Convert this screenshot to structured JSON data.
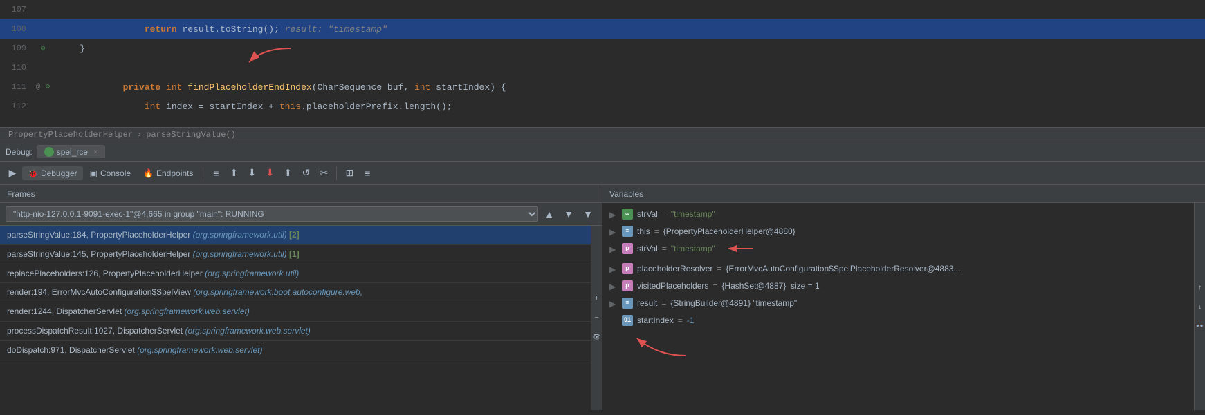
{
  "code": {
    "lines": [
      {
        "num": 107,
        "content": "",
        "highlighted": false,
        "gutter": ""
      },
      {
        "num": 108,
        "content": "        return result.toString();",
        "comment": "   result: \"timestamp\"",
        "highlighted": true,
        "gutter": ""
      },
      {
        "num": 109,
        "content": "    }",
        "highlighted": false,
        "gutter": "⊙"
      },
      {
        "num": 110,
        "content": "",
        "highlighted": false,
        "gutter": ""
      },
      {
        "num": 111,
        "content": "    private int findPlaceholderEndIndex(CharSequence buf, int startIndex) {",
        "highlighted": false,
        "gutter": "@",
        "gutter2": "⊙"
      },
      {
        "num": 112,
        "content": "        int index = startIndex + this.placeholderPrefix.length();",
        "highlighted": false,
        "gutter": ""
      }
    ]
  },
  "breadcrumb": {
    "class": "PropertyPlaceholderHelper",
    "method": "parseStringValue()",
    "separator": "›"
  },
  "debug": {
    "label": "Debug:",
    "tab": "spel_rce",
    "close": "×"
  },
  "toolbar": {
    "debugger_label": "Debugger",
    "console_label": "Console",
    "endpoints_label": "Endpoints"
  },
  "frames": {
    "header": "Frames",
    "thread_label": "\"http-nio-127.0.0.1-9091-exec-1\"@4,665 in group \"main\": RUNNING",
    "items": [
      {
        "method": "parseStringValue:184,",
        "class": "PropertyPlaceholderHelper",
        "package": "(org.springframework.util)",
        "num": "[2]",
        "active": true
      },
      {
        "method": "parseStringValue:145,",
        "class": "PropertyPlaceholderHelper",
        "package": "(org.springframework.util)",
        "num": "[1]",
        "active": false
      },
      {
        "method": "replacePlaceholders:126,",
        "class": "PropertyPlaceholderHelper",
        "package": "(org.springframework.util)",
        "num": "",
        "active": false
      },
      {
        "method": "render:194,",
        "class": "ErrorMvcAutoConfiguration$SpelView",
        "package": "(org.springframework.boot.autoconfigure.web,",
        "num": "",
        "active": false
      },
      {
        "method": "render:1244,",
        "class": "DispatcherServlet",
        "package": "(org.springframework.web.servlet)",
        "num": "",
        "active": false
      },
      {
        "method": "processDispatchResult:1027,",
        "class": "DispatcherServlet",
        "package": "(org.springframework.web.servlet)",
        "num": "",
        "active": false
      },
      {
        "method": "doDispatch:971,",
        "class": "DispatcherServlet",
        "package": "(org.springframework.web.servlet)",
        "num": "",
        "active": false
      }
    ]
  },
  "variables": {
    "header": "Variables",
    "items": [
      {
        "icon": "oo",
        "toggle": "▶",
        "name": "strVal",
        "eq": " = ",
        "value": "\"timestamp\"",
        "type": "string"
      },
      {
        "icon": "eq",
        "toggle": "▶",
        "name": "this",
        "eq": " = ",
        "value": "{PropertyPlaceholderHelper@4880}",
        "type": "obj"
      },
      {
        "icon": "p",
        "toggle": "▶",
        "name": "strVal",
        "eq": " = ",
        "value": "\"timestamp\"",
        "type": "string",
        "arrow": true
      },
      {
        "icon": "p",
        "toggle": "▶",
        "name": "placeholderResolver",
        "eq": " = ",
        "value": "{ErrorMvcAutoConfiguration$SpelPlaceholderResolver@4883...",
        "type": "obj"
      },
      {
        "icon": "p",
        "toggle": "▶",
        "name": "visitedPlaceholders",
        "eq": " = ",
        "value": "{HashSet@4887}  size = 1",
        "type": "obj"
      },
      {
        "icon": "eq",
        "toggle": "▶",
        "name": "result",
        "eq": " = ",
        "value": "{StringBuilder@4891} \"timestamp\"",
        "type": "obj"
      },
      {
        "icon": "o1",
        "toggle": "",
        "name": "startIndex",
        "eq": " = ",
        "value": "-1",
        "type": "num",
        "arrow": true
      }
    ]
  }
}
